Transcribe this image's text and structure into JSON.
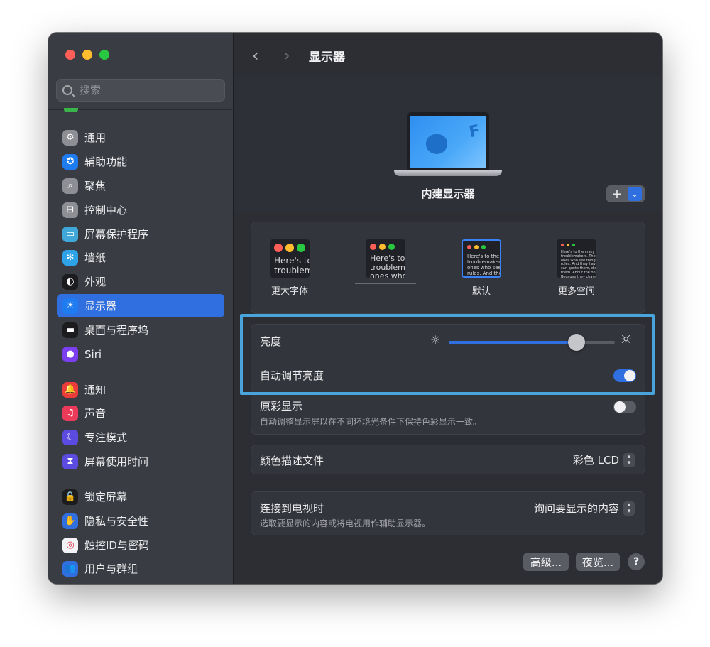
{
  "window": {
    "title": "显示器"
  },
  "search": {
    "placeholder": "搜索"
  },
  "sidebar": {
    "items": [
      {
        "label": "通用",
        "icon": "gear-icon",
        "color": "#8e8f94"
      },
      {
        "label": "辅助功能",
        "icon": "accessibility-icon",
        "color": "#1e7cf0"
      },
      {
        "label": "聚焦",
        "icon": "spotlight-icon",
        "color": "#8e8f94"
      },
      {
        "label": "控制中心",
        "icon": "control-center-icon",
        "color": "#8e8f94"
      },
      {
        "label": "屏幕保护程序",
        "icon": "screensaver-icon",
        "color": "#3fa8d8"
      },
      {
        "label": "墙纸",
        "icon": "wallpaper-icon",
        "color": "#2ea3e8"
      },
      {
        "label": "外观",
        "icon": "appearance-icon",
        "color": "#1c1c1e"
      },
      {
        "label": "显示器",
        "icon": "display-brightness-icon",
        "color": "#1e7cf0"
      },
      {
        "label": "桌面与程序坞",
        "icon": "dock-icon",
        "color": "#1c1c1e"
      },
      {
        "label": "Siri",
        "icon": "siri-icon",
        "color": "#7b3ff0"
      },
      {
        "label": "通知",
        "icon": "notification-bell-icon",
        "color": "#ec3b3b"
      },
      {
        "label": "声音",
        "icon": "speaker-icon",
        "color": "#ec3b5a"
      },
      {
        "label": "专注模式",
        "icon": "moon-icon",
        "color": "#5b4be0"
      },
      {
        "label": "屏幕使用时间",
        "icon": "hourglass-icon",
        "color": "#5b4be0"
      },
      {
        "label": "锁定屏幕",
        "icon": "lock-icon",
        "color": "#1c1c1e"
      },
      {
        "label": "隐私与安全性",
        "icon": "hand-icon",
        "color": "#2f6fe0"
      },
      {
        "label": "触控ID与密码",
        "icon": "fingerprint-icon",
        "color": "#f4f4f6"
      },
      {
        "label": "用户与群组",
        "icon": "users-icon",
        "color": "#2f6fe0"
      }
    ]
  },
  "display": {
    "name": "内建显示器"
  },
  "resolution": {
    "options": [
      {
        "label": "更大字体",
        "preview": [
          "Here's to",
          "troublem"
        ]
      },
      {
        "label": "",
        "preview": [
          "Here's to t",
          "troublema",
          "ones who"
        ]
      },
      {
        "label": "默认",
        "preview": [
          "Here's to the c",
          "troublemakers.",
          "ones who see t",
          "rules. And they"
        ]
      },
      {
        "label": "更多空间",
        "preview": [
          "Here's to the crazy one",
          "troublemakers. The rou",
          "ones who see things di",
          "rules. And they have no",
          "can quote them, disagr",
          "them. About the only t",
          "Because they change t"
        ]
      }
    ]
  },
  "brightness": {
    "label": "亮度",
    "level": 0.77
  },
  "auto_brightness": {
    "label": "自动调节亮度",
    "on": true
  },
  "true_tone": {
    "label": "原彩显示",
    "description": "自动调整显示屏以在不同环境光条件下保持色彩显示一致。",
    "on": false
  },
  "color_profile": {
    "label": "颜色描述文件",
    "value": "彩色 LCD"
  },
  "tv": {
    "label": "连接到电视时",
    "value": "询问要显示的内容",
    "description": "选取要显示的内容或将电视用作辅助显示器。"
  },
  "buttons": {
    "advanced": "高级...",
    "night_shift": "夜览...",
    "help": "?"
  }
}
